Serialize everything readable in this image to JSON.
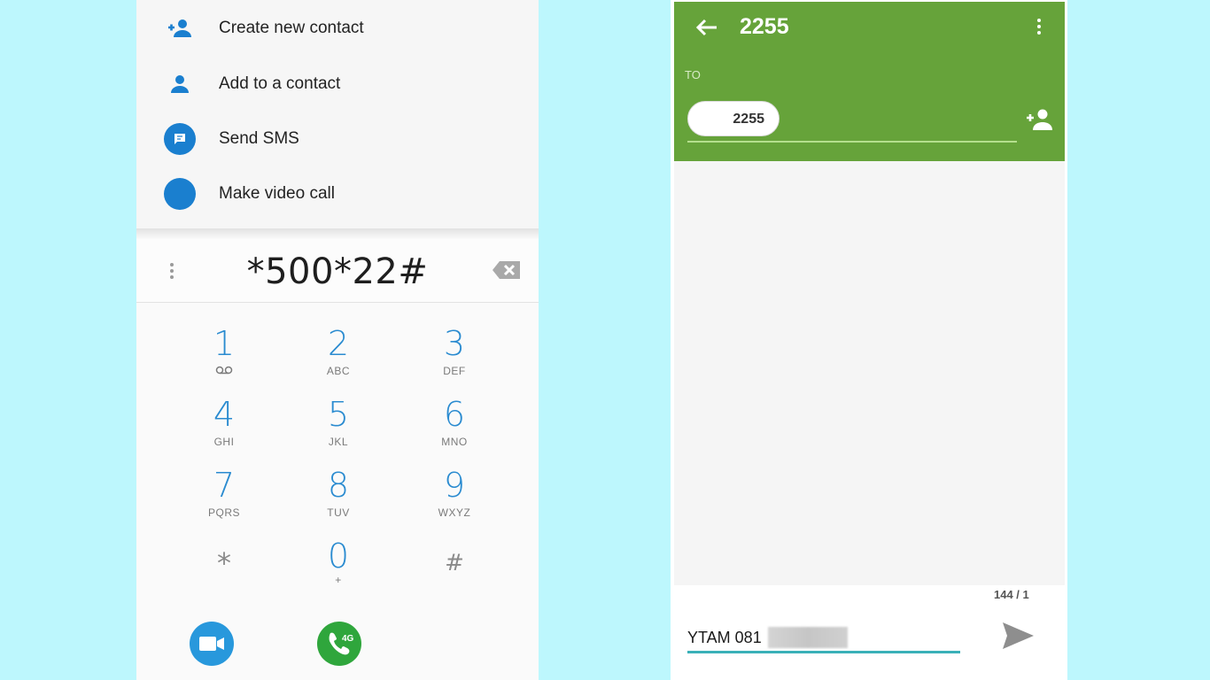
{
  "dialer": {
    "menu": [
      {
        "label": "Create new contact",
        "icon": "person-add-icon"
      },
      {
        "label": "Add to a contact",
        "icon": "person-icon"
      },
      {
        "label": "Send SMS",
        "icon": "message-icon"
      },
      {
        "label": "Make video call",
        "icon": "video-call-icon"
      }
    ],
    "number": "*500*22#",
    "keys": [
      {
        "digit": "1",
        "letters": "ꝺꝺ"
      },
      {
        "digit": "2",
        "letters": "ABC"
      },
      {
        "digit": "3",
        "letters": "DEF"
      },
      {
        "digit": "4",
        "letters": "GHI"
      },
      {
        "digit": "5",
        "letters": "JKL"
      },
      {
        "digit": "6",
        "letters": "MNO"
      },
      {
        "digit": "7",
        "letters": "PQRS"
      },
      {
        "digit": "8",
        "letters": "TUV"
      },
      {
        "digit": "9",
        "letters": "WXYZ"
      },
      {
        "digit": "*",
        "letters": ""
      },
      {
        "digit": "0",
        "letters": "+"
      },
      {
        "digit": "#",
        "letters": ""
      }
    ],
    "call_badge": "4G",
    "colors": {
      "accent": "#2a8bd0",
      "video": "#2898dc",
      "call": "#2fa63c"
    }
  },
  "messages": {
    "title": "2255",
    "to_label": "TO",
    "recipient": "2255",
    "char_counter": "144 / 1",
    "compose_text": "YTAM 081",
    "colors": {
      "header": "#66a33a",
      "input_underline": "#3ab0b8"
    }
  }
}
